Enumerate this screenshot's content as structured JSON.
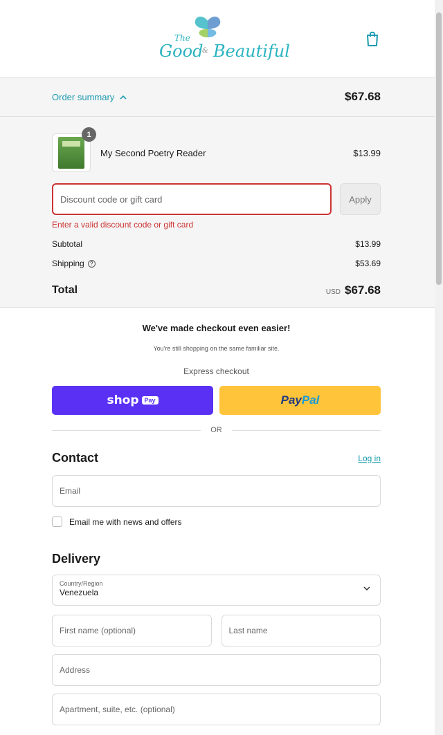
{
  "brand": {
    "line1": "The",
    "word1": "Good",
    "amp": "&",
    "word2": "Beautiful"
  },
  "summary": {
    "toggle_label": "Order summary",
    "header_total": "$67.68"
  },
  "item": {
    "quantity": "1",
    "name": "My Second Poetry Reader",
    "price": "$13.99"
  },
  "discount": {
    "placeholder": "Discount code or gift card",
    "apply_label": "Apply",
    "error": "Enter a valid discount code or gift card"
  },
  "costs": {
    "subtotal_label": "Subtotal",
    "subtotal": "$13.99",
    "shipping_label": "Shipping",
    "shipping": "$53.69",
    "total_label": "Total",
    "currency": "USD",
    "total": "$67.68"
  },
  "notice": {
    "title": "We've made checkout even easier!",
    "subtitle": "You're still shopping on the same familiar site."
  },
  "express": {
    "label": "Express checkout",
    "shop": "shop",
    "shop_pay": "Pay",
    "paypal_1": "Pay",
    "paypal_2": "Pal",
    "or": "OR"
  },
  "contact": {
    "heading": "Contact",
    "login": "Log in",
    "email_placeholder": "Email",
    "newsletter_label": "Email me with news and offers"
  },
  "delivery": {
    "heading": "Delivery",
    "country_label": "Country/Region",
    "country_value": "Venezuela",
    "first_name_placeholder": "First name (optional)",
    "last_name_placeholder": "Last name",
    "address_placeholder": "Address",
    "apartment_placeholder": "Apartment, suite, etc. (optional)"
  },
  "colors": {
    "accent": "#1b9bb0",
    "error": "#cc3333",
    "shop_pay": "#5a31f4",
    "paypal": "#ffc439"
  }
}
